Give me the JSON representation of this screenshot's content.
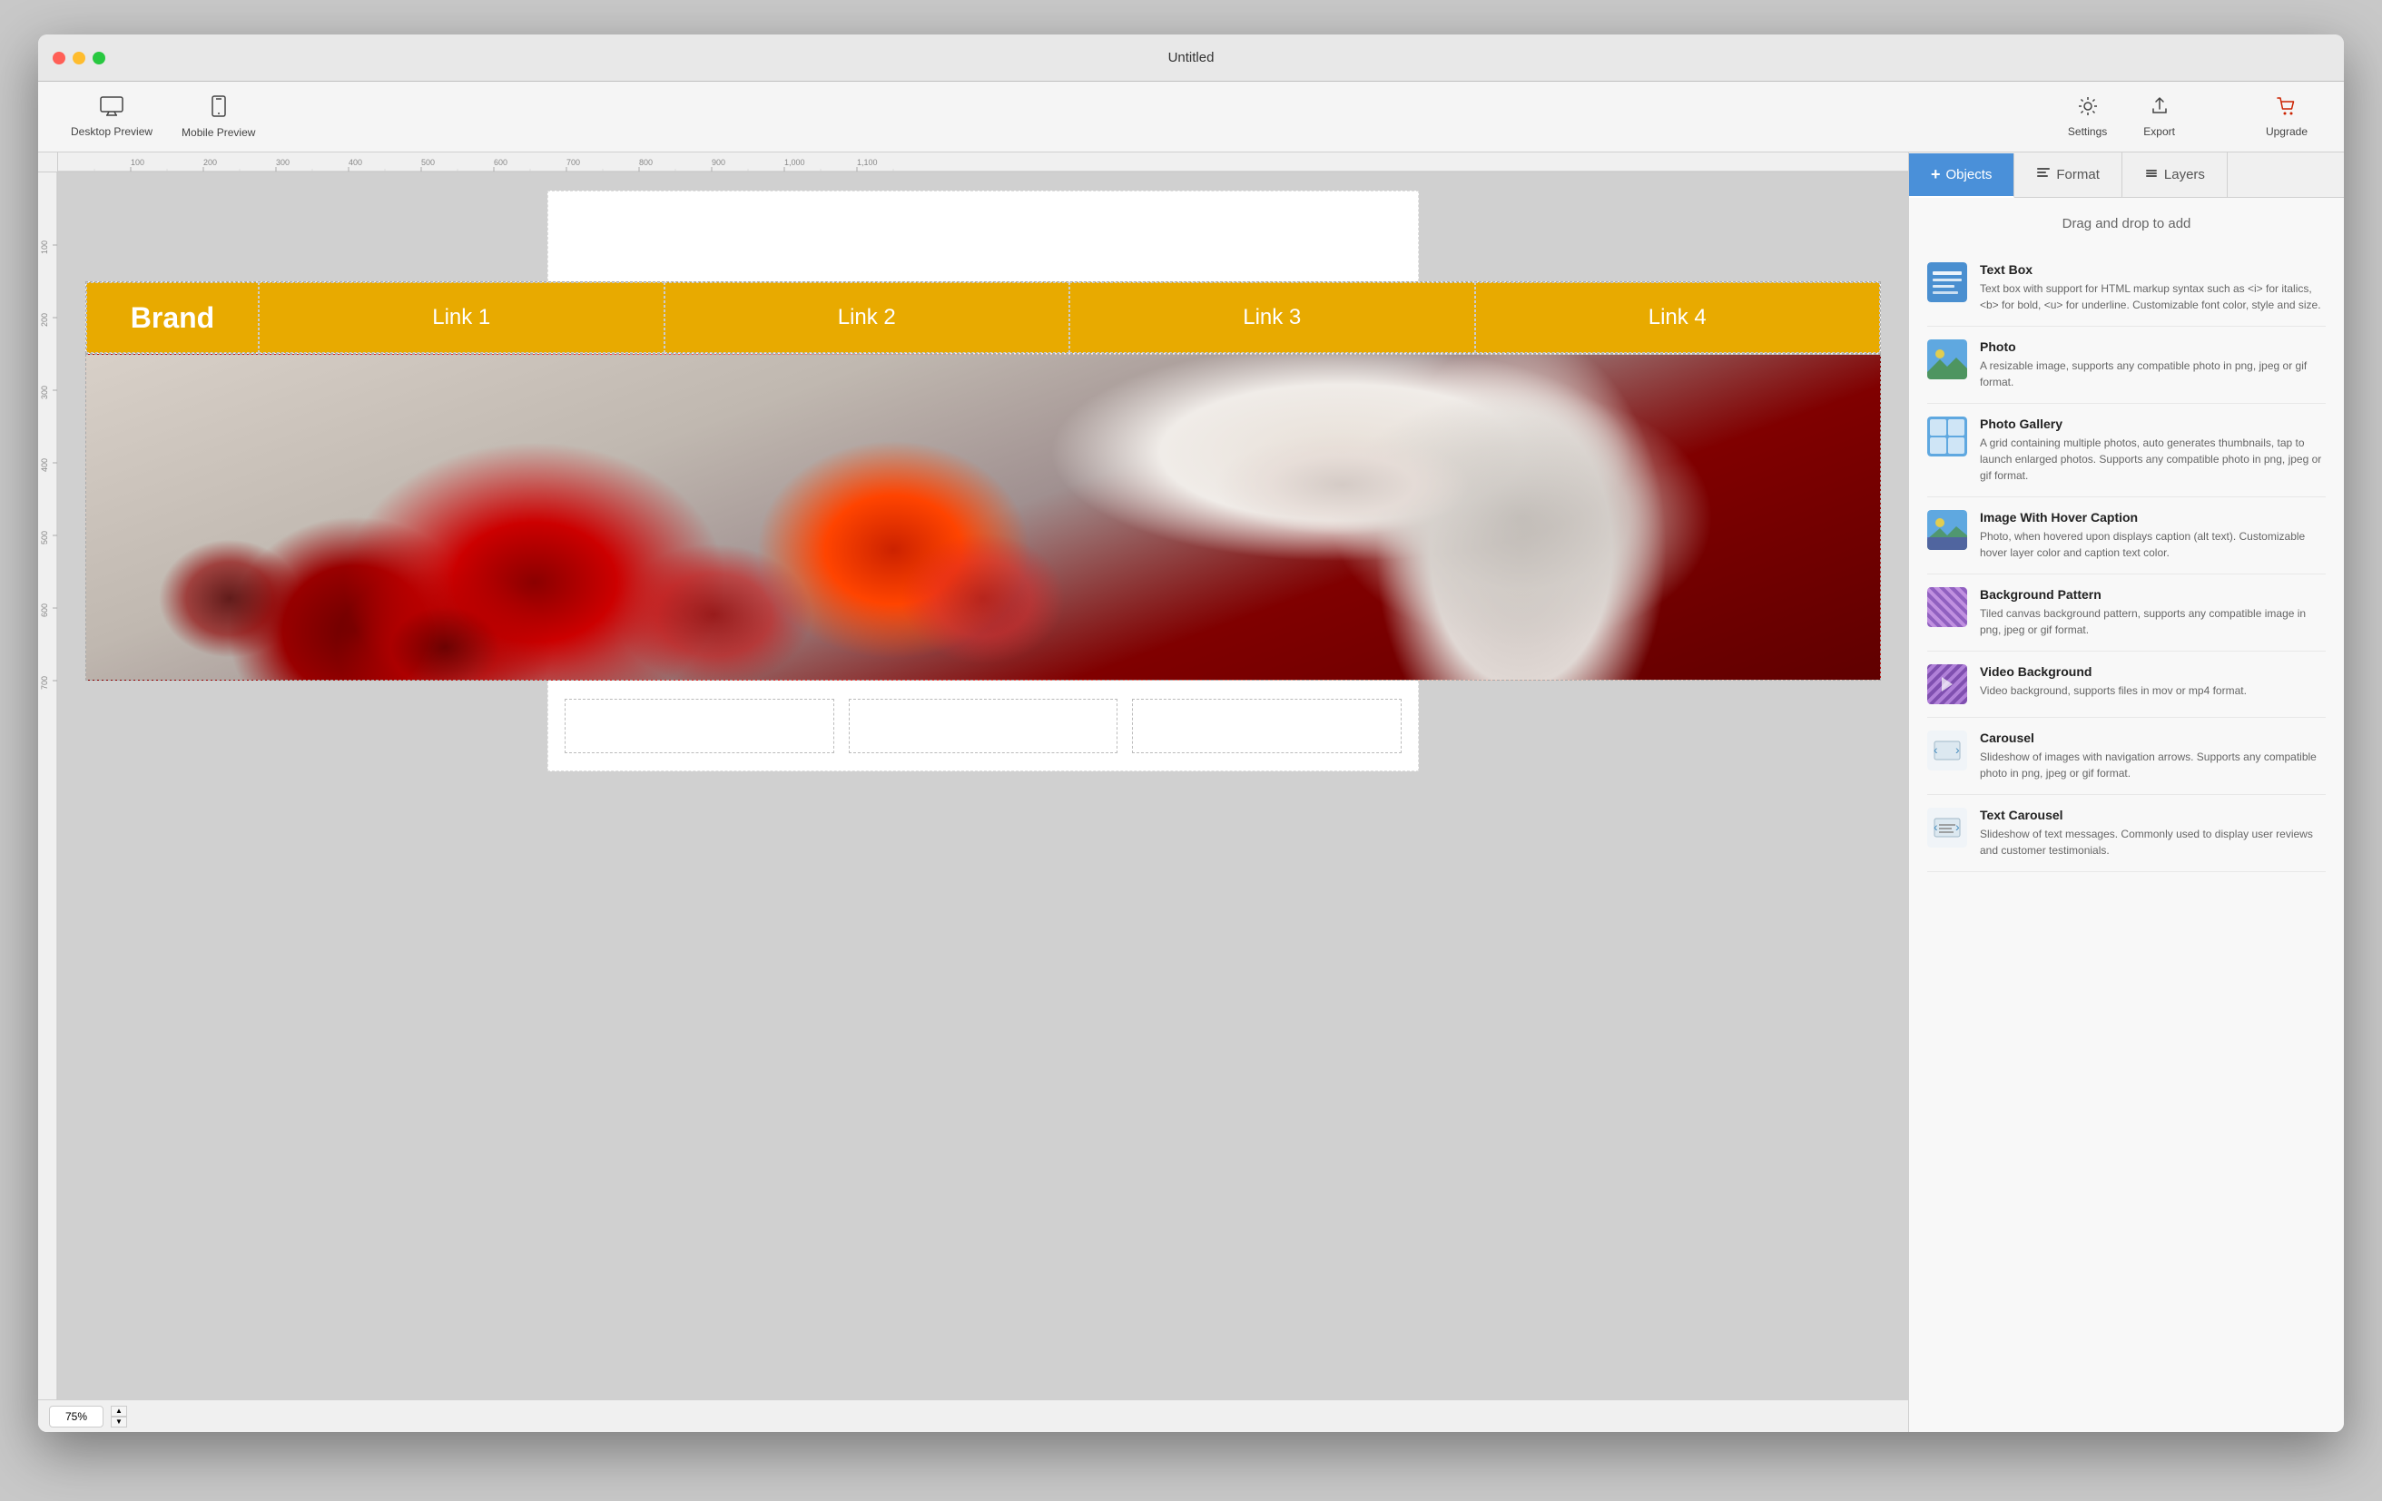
{
  "window": {
    "title": "Untitled",
    "close_btn": "●",
    "min_btn": "●",
    "max_btn": "●"
  },
  "toolbar": {
    "desktop_preview_label": "Desktop Preview",
    "mobile_preview_label": "Mobile Preview",
    "settings_label": "Settings",
    "export_label": "Export",
    "upgrade_label": "Upgrade"
  },
  "nav": {
    "brand": "Brand",
    "links": [
      "Link 1",
      "Link 2",
      "Link 3",
      "Link 4"
    ]
  },
  "right_panel": {
    "tabs": [
      {
        "id": "objects",
        "label": "Objects",
        "active": true,
        "add": true
      },
      {
        "id": "format",
        "label": "Format",
        "active": false
      },
      {
        "id": "layers",
        "label": "Layers",
        "active": false
      }
    ],
    "drag_hint": "Drag and drop to add",
    "objects": [
      {
        "id": "text-box",
        "title": "Text Box",
        "desc": "Text box with support for HTML markup syntax such as <i> for italics, <b> for bold, <u> for underline. Customizable font color, style and size.",
        "icon_type": "textbox"
      },
      {
        "id": "photo",
        "title": "Photo",
        "desc": "A resizable image, supports any compatible photo in png, jpeg or gif format.",
        "icon_type": "photo"
      },
      {
        "id": "photo-gallery",
        "title": "Photo Gallery",
        "desc": "A grid containing multiple photos, auto generates thumbnails, tap to launch enlarged photos. Supports any compatible photo in png, jpeg or gif format.",
        "icon_type": "gallery"
      },
      {
        "id": "image-hover-caption",
        "title": "Image With Hover Caption",
        "desc": "Photo, when hovered upon displays caption (alt text). Customizable hover layer color and caption text color.",
        "icon_type": "hover"
      },
      {
        "id": "background-pattern",
        "title": "Background Pattern",
        "desc": "Tiled canvas background pattern, supports any compatible image in png, jpeg or gif format.",
        "icon_type": "pattern"
      },
      {
        "id": "video-background",
        "title": "Video Background",
        "desc": "Video background, supports files in mov or mp4 format.",
        "icon_type": "video"
      },
      {
        "id": "carousel",
        "title": "Carousel",
        "desc": "Slideshow of images with navigation arrows. Supports any compatible photo in png, jpeg or gif format.",
        "icon_type": "carousel"
      },
      {
        "id": "text-carousel",
        "title": "Text Carousel",
        "desc": "Slideshow of text messages. Commonly used to display user reviews and customer testimonials.",
        "icon_type": "text-carousel"
      }
    ]
  },
  "status_bar": {
    "zoom": "75%"
  },
  "ruler": {
    "marks": [
      "100",
      "200",
      "300",
      "400",
      "500",
      "600",
      "700",
      "800",
      "900",
      "1,000",
      "1,100"
    ]
  }
}
